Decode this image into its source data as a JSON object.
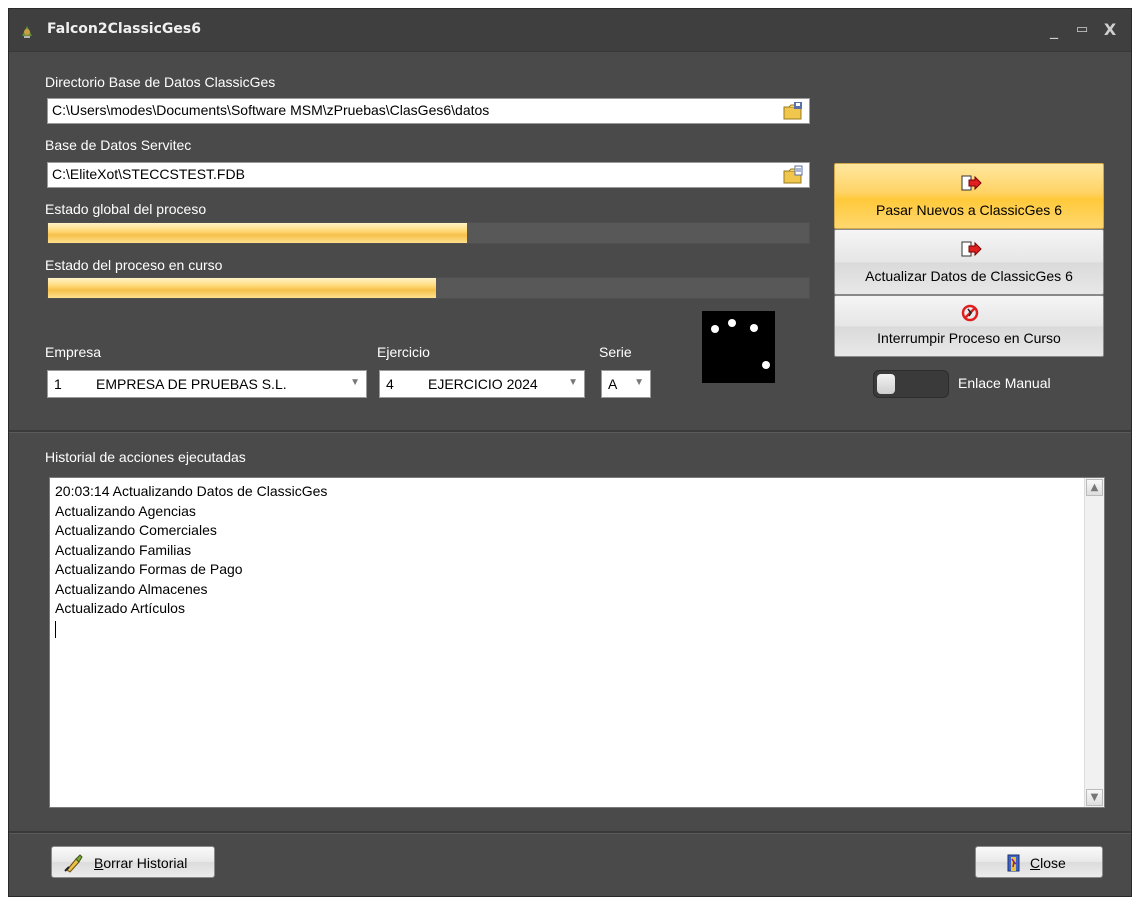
{
  "window": {
    "title": "Falcon2ClassicGes6",
    "controls": {
      "minimize": "_",
      "maximize": "▭",
      "close": "X"
    }
  },
  "fields": {
    "dir_label": "Directorio Base de Datos ClassicGes",
    "dir_value": "C:\\Users\\modes\\Documents\\Software MSM\\zPruebas\\ClasGes6\\datos",
    "db_label": "Base de Datos Servitec",
    "db_value": "C:\\EliteXot\\STECCSTEST.FDB"
  },
  "progress": {
    "global_label": "Estado global del proceso",
    "global_fraction": 0.55,
    "current_label": "Estado del proceso en curso",
    "current_fraction": 0.51
  },
  "selectors": {
    "empresa_label": "Empresa",
    "empresa_code": "1",
    "empresa_name": "EMPRESA DE PRUEBAS S.L.",
    "ejercicio_label": "Ejercicio",
    "ejercicio_code": "4",
    "ejercicio_name": "EJERCICIO 2024",
    "serie_label": "Serie",
    "serie_value": "A"
  },
  "actions": {
    "pasar_nuevos": "Pasar Nuevos a ClassicGes 6",
    "actualizar": "Actualizar Datos de ClassicGes 6",
    "interrumpir": "Interrumpir Proceso en Curso",
    "enlace_manual": "Enlace Manual"
  },
  "history": {
    "label": "Historial de acciones ejecutadas",
    "lines": [
      "20:03:14 Actualizando Datos de ClassicGes",
      "Actualizando Agencias",
      "Actualizando Comerciales",
      "Actualizando Familias",
      "Actualizando Formas de Pago",
      "Actualizando Almacenes",
      "Actualizado Artículos"
    ]
  },
  "footer": {
    "borrar_first": "B",
    "borrar_rest": "orrar Historial",
    "close_first": "C",
    "close_rest": "lose"
  }
}
